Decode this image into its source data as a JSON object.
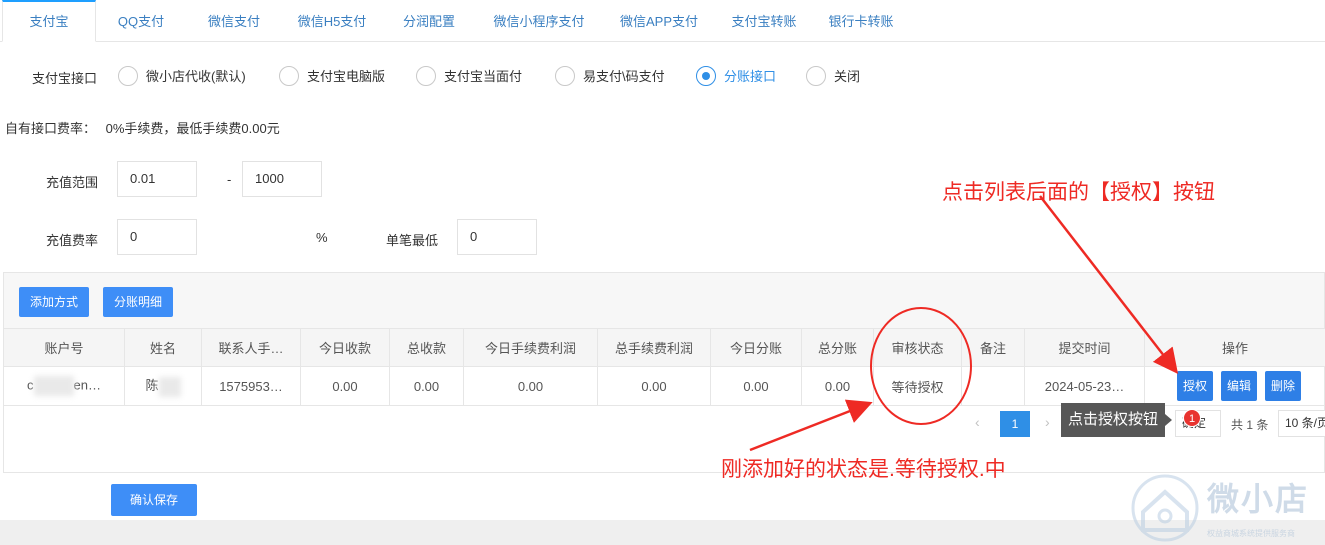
{
  "tabs": [
    {
      "label": "支付宝"
    },
    {
      "label": "QQ支付"
    },
    {
      "label": "微信支付"
    },
    {
      "label": "微信H5支付"
    },
    {
      "label": "分润配置"
    },
    {
      "label": "微信小程序支付"
    },
    {
      "label": "微信APP支付"
    },
    {
      "label": "支付宝转账"
    },
    {
      "label": "银行卡转账"
    }
  ],
  "interface": {
    "label": "支付宝接口",
    "options": [
      {
        "label": "微小店代收(默认)",
        "selected": false
      },
      {
        "label": "支付宝电脑版",
        "selected": false
      },
      {
        "label": "支付宝当面付",
        "selected": false
      },
      {
        "label": "易支付\\码支付",
        "selected": false
      },
      {
        "label": "分账接口",
        "selected": true
      },
      {
        "label": "关闭",
        "selected": false
      }
    ]
  },
  "fee_info": {
    "label": "自有接口费率：",
    "value": "0%手续费，最低手续费0.00元"
  },
  "recharge_range": {
    "label": "充值范围",
    "min": "0.01",
    "separator": "-",
    "max": "1000"
  },
  "recharge_fee": {
    "label": "充值费率",
    "value": "0",
    "unit": "%",
    "min_label": "单笔最低",
    "min_value": "0"
  },
  "toolbar": {
    "add_label": "添加方式",
    "detail_label": "分账明细"
  },
  "table": {
    "headers": [
      "账户号",
      "姓名",
      "联系人手…",
      "今日收款",
      "总收款",
      "今日手续费利润",
      "总手续费利润",
      "今日分账",
      "总分账",
      "审核状态",
      "备注",
      "提交时间",
      "操作"
    ],
    "rows": [
      {
        "account_start": "c",
        "account_end": "en…",
        "name": "陈",
        "phone": "1575953…",
        "today_income": "0.00",
        "total_income": "0.00",
        "today_fee_profit": "0.00",
        "total_fee_profit": "0.00",
        "today_split": "0.00",
        "total_split": "0.00",
        "status": "等待授权",
        "note": "",
        "submit_time": "2024-05-23…",
        "actions": {
          "authorize": "授权",
          "edit": "编辑",
          "delete": "删除"
        }
      }
    ]
  },
  "pagination": {
    "prev": "‹",
    "page": "1",
    "next": "›",
    "confirm": "确定",
    "total": "共 1 条",
    "per_page": "10 条/页"
  },
  "tooltip": {
    "text": "点击授权按钮",
    "badge": "1"
  },
  "annotations": {
    "top_right": "点击列表后面的【授权】按钮",
    "bottom": "刚添加好的状态是.等待授权.中"
  },
  "save_label": "确认保存",
  "watermark": {
    "title": "微小店",
    "subtitle": "权益商城系统提供服务商"
  },
  "colors": {
    "accent": "#3e8ef7",
    "annotation": "#ee2a24",
    "status_wait": "#e4562c"
  }
}
